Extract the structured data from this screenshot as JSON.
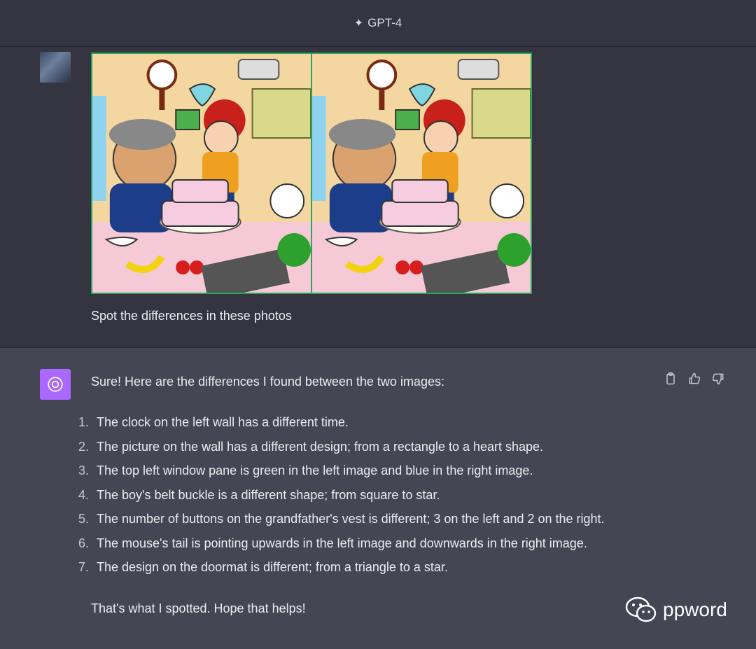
{
  "header": {
    "model_label": "GPT-4",
    "icon": "sparkle-icon"
  },
  "user": {
    "avatar": "user-avatar",
    "message": "Spot the differences in these photos",
    "image_border_color": "#27a55b"
  },
  "assistant": {
    "avatar_color": "#ab68ff",
    "intro": "Sure! Here are the differences I found between the two images:",
    "actions": {
      "copy_icon": "clipboard-icon",
      "like_icon": "thumbs-up-icon",
      "dislike_icon": "thumbs-down-icon"
    },
    "differences": [
      {
        "num": "1.",
        "text": "The clock on the left wall has a different time."
      },
      {
        "num": "2.",
        "text": "The picture on the wall has a different design; from a rectangle to a heart shape."
      },
      {
        "num": "3.",
        "text": "The top left window pane is green in the left image and blue in the right image."
      },
      {
        "num": "4.",
        "text": "The boy's belt buckle is a different shape; from square to star."
      },
      {
        "num": "5.",
        "text": "The number of buttons on the grandfather's vest is different; 3 on the left and 2 on the right."
      },
      {
        "num": "6.",
        "text": "The mouse's tail is pointing upwards in the left image and downwards in the right image."
      },
      {
        "num": "7.",
        "text": "The design on the doormat is different; from a triangle to a star."
      }
    ],
    "outro": "That's what I spotted. Hope that helps!"
  },
  "watermark": {
    "text": "ppword",
    "icon": "wechat-icon"
  }
}
